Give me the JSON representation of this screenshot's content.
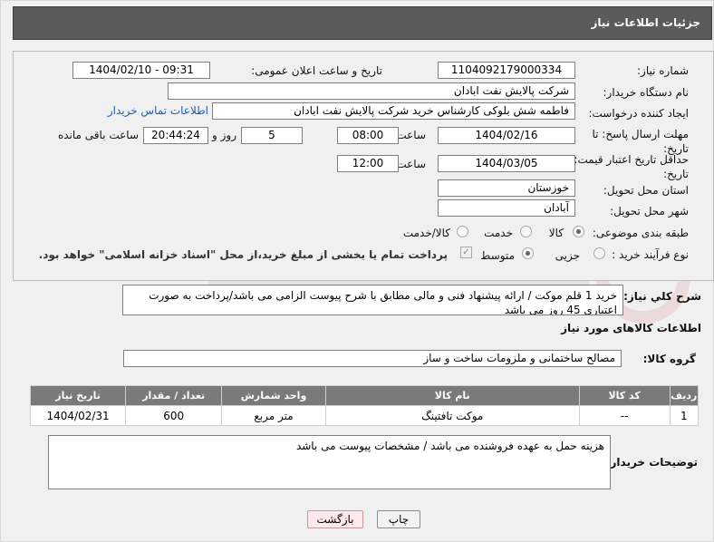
{
  "header": {
    "title": "جزئیات اطلاعات نیاز"
  },
  "fields": {
    "need_number_label": "شماره نیاز:",
    "need_number": "1104092179000334",
    "announce_label": "تاریخ و ساعت اعلان عمومی:",
    "announce_value": "1404/02/10 - 09:31",
    "buyer_org_label": "نام دستگاه خریدار:",
    "buyer_org": "شرکت پالایش نفت ابادان",
    "creator_label": "ایجاد کننده درخواست:",
    "creator": "فاطمه شش بلوکی کارشناس خرید شرکت پالایش نفت ابادان",
    "contact_link": "اطلاعات تماس خریدار",
    "reply_deadline_label": "مهلت ارسال پاسخ: تا تاریخ:",
    "reply_date": "1404/02/16",
    "hour_label": "ساعت",
    "reply_time": "08:00",
    "days_value": "5",
    "days_label": "روز و",
    "remaining_time": "20:44:24",
    "remaining_label": "ساعت باقی مانده",
    "price_validity_label": "حداقل تاریخ اعتبار قیمت: تا تاریخ:",
    "price_date": "1404/03/05",
    "price_time": "12:00",
    "province_label": "استان محل تحویل:",
    "province": "خوزستان",
    "city_label": "شهر محل تحویل:",
    "city": "آبادان",
    "category_label": "طبقه بندی موضوعی:",
    "category_options": [
      "کالا",
      "خدمت",
      "کالا/خدمت"
    ],
    "process_label": "نوع فرآیند خرید :",
    "process_options": [
      "جزیی",
      "متوسط"
    ],
    "payment_note": "پرداخت تمام یا بخشی از مبلغ خرید،از محل \"اسناد خزانه اسلامی\" خواهد بود."
  },
  "description": {
    "label": "شرح کلي نياز:",
    "text": "خرید 1 قلم موکت / ارائه پیشنهاد فنی و مالی مطابق با شرح پیوست الزامی می باشد/پرداخت به صورت اعتباری 45 روز می باشد"
  },
  "goods": {
    "section_title": "اطلاعات کالاهای مورد نیاز",
    "group_label": "گروه کالا:",
    "group_value": "مصالح ساختمانی و ملزومات ساخت و ساز",
    "columns": [
      "ردیف",
      "کد کالا",
      "نام کالا",
      "واحد شمارش",
      "تعداد / مقدار",
      "تاریخ نیاز"
    ],
    "rows": [
      {
        "index": "1",
        "code": "--",
        "name": "موکت تافتینگ",
        "unit": "متر مربع",
        "qty": "600",
        "date": "1404/02/31"
      }
    ]
  },
  "buyer_notes": {
    "label": "توضیحات خریدار:",
    "text": "هزینه حمل به عهده فروشنده می باشد / مشخصات پیوست می باشد"
  },
  "buttons": {
    "print": "چاپ",
    "back": "بازگشت"
  }
}
